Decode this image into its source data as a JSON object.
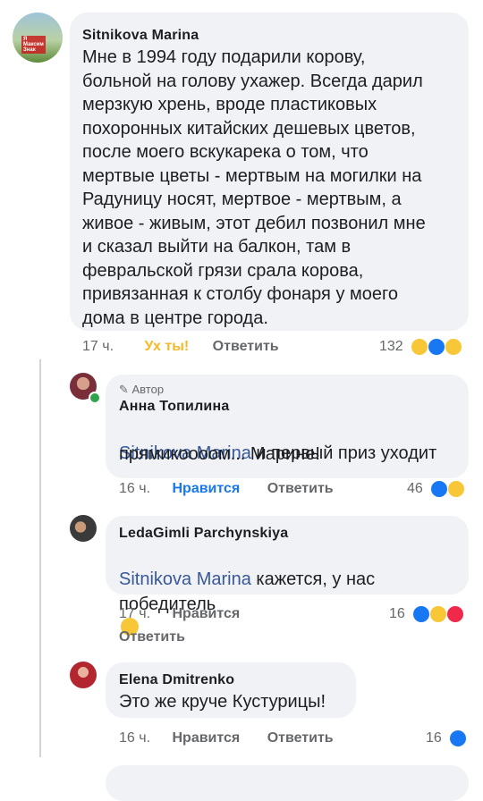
{
  "colors": {
    "bubble": "#f0f2f5",
    "mention": "#385898",
    "like": "#1877f2",
    "wow_label": "#f7b928",
    "meta": "#65676b"
  },
  "comments": [
    {
      "author": "Sitnikova Marina",
      "avatar_label": "Я\nМаксим\nЗнак",
      "text": "Мне в 1994 году подарили корову,\nбольной на голову ухажер. Всегда дарил\nмерзкую хрень, вроде пластиковых\nпохоронных китайских дешевых цветов,\nпосле моего вскукарека о том, что\nмертвые цветы - мертвым на могилки на\nРадуницу носят, мертвое - мертвым, а\nживое - живым, этот дебил позвонил мне\nи сказал выйти на балкон, там в\nфевральской грязи срала корова,\nпривязанная к столбу фонаря у моего\nдома в центре города.",
      "time": "17 ч.",
      "reaction_label": "Ух ты!",
      "reply_label": "Ответить",
      "count": "132"
    },
    {
      "author_badge": "Автор",
      "author": "Анна Топилина",
      "mention": "Sitnikova Marina",
      "text_after": " и первый приз уходит",
      "text_line2": "прямикоооом... Марине!",
      "time": "16 ч.",
      "like_label": "Нравится",
      "reply_label": "Ответить",
      "count": "46"
    },
    {
      "author": "LedaGimli Parchynskiya",
      "mention": "Sitnikova Marina",
      "text_after": " кажется, у нас",
      "text_line2": "победитель",
      "time": "17 ч.",
      "like_label": "Нравится",
      "reply_label": "Ответить",
      "count": "16"
    },
    {
      "author": "Elena Dmitrenko",
      "text": "Это же круче Кустурицы!",
      "time": "16 ч.",
      "like_label": "Нравится",
      "reply_label": "Ответить",
      "count": "16"
    }
  ]
}
